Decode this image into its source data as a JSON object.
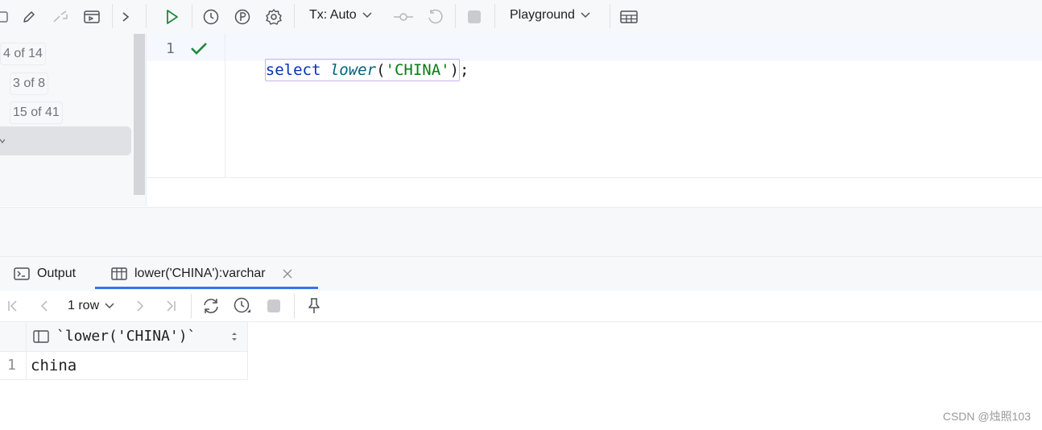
{
  "toolbar": {
    "tx_label": "Tx: Auto",
    "playground_label": "Playground"
  },
  "sidebar": {
    "badges": [
      "4 of 14",
      "3 of 8",
      "15 of 41"
    ]
  },
  "editor": {
    "line_number": "1",
    "code": {
      "keyword": "select",
      "function": "lower",
      "open_paren": "(",
      "string": "'CHINA'",
      "close_paren": ")",
      "semicolon": ";"
    }
  },
  "results": {
    "tabs": [
      {
        "label": "Output"
      },
      {
        "label": "lower('CHINA'):varchar"
      }
    ],
    "row_count_label": "1 row",
    "columns": [
      "`lower('CHINA')`"
    ],
    "rows": [
      {
        "num": "1",
        "values": [
          "china"
        ]
      }
    ]
  },
  "colors": {
    "accent": "#3574f0",
    "run_green": "#208a3c",
    "keyword_blue": "#0033b3",
    "string_green": "#067d17",
    "function_teal": "#00627a"
  },
  "watermark": "CSDN @烛照103"
}
